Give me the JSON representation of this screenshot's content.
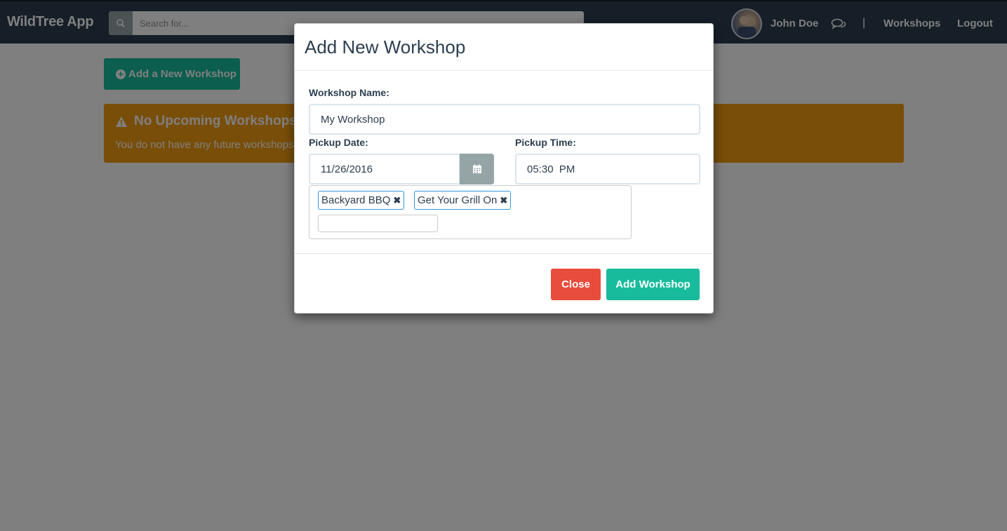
{
  "navbar": {
    "brand": "WildTree App",
    "search_placeholder": "Search for...",
    "user_name": "John Doe",
    "separator": "|",
    "links": [
      "Workshops",
      "Logout"
    ]
  },
  "page": {
    "add_button_label": "Add a New Workshop",
    "alert": {
      "title": "No Upcoming Workshops A",
      "text": "You do not have any future workshops a"
    }
  },
  "modal": {
    "title": "Add New Workshop",
    "workshop_name_label": "Workshop Name:",
    "workshop_name_value": "My Workshop",
    "pickup_date_label": "Pickup Date:",
    "pickup_date_value": "11/26/2016",
    "pickup_time_label": "Pickup Time:",
    "pickup_time_value": "05:30  PM",
    "tags": [
      "Backyard BBQ",
      "Get Your Grill On"
    ],
    "tag_remove_glyph": "✖",
    "close_label": "Close",
    "submit_label": "Add Workshop"
  },
  "colors": {
    "navbar": "#2c3e50",
    "primary": "#18bc9c",
    "warning": "#f39c12",
    "danger": "#e74c3c",
    "tag_border": "#3498db"
  },
  "icons": [
    "search-icon",
    "chat-icon",
    "plus-circle-icon",
    "warning-icon",
    "calendar-icon",
    "remove-tag-icon"
  ]
}
